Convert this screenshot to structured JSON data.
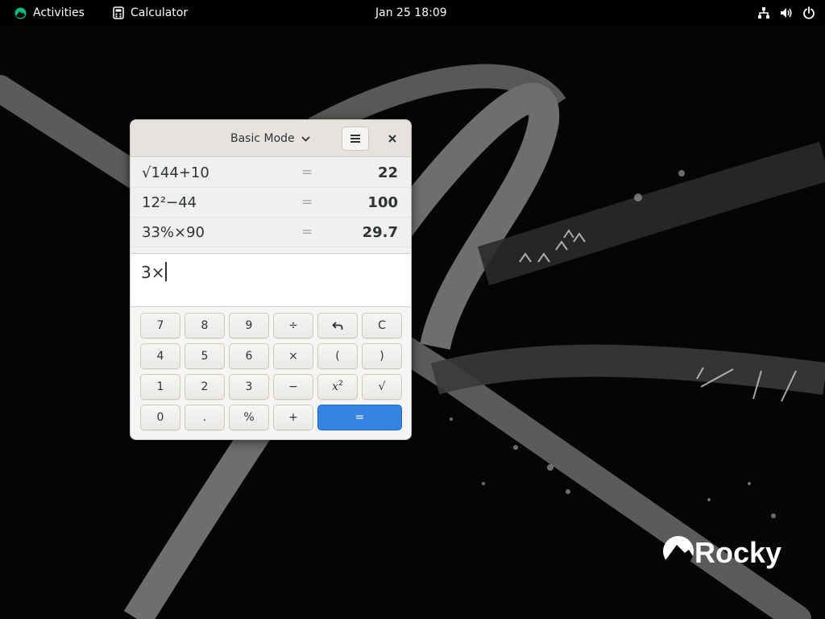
{
  "topbar": {
    "activities_label": "Activities",
    "app_name": "Calculator",
    "clock": "Jan 25  18:09"
  },
  "window": {
    "mode_label": "Basic Mode"
  },
  "history": [
    {
      "expression": "√144+10",
      "equals": "=",
      "result": "22"
    },
    {
      "expression": "12²−44",
      "equals": "=",
      "result": "100"
    },
    {
      "expression": "33%×90",
      "equals": "=",
      "result": "29.7"
    }
  ],
  "entry": {
    "value": "3×"
  },
  "keys": {
    "k7": "7",
    "k8": "8",
    "k9": "9",
    "div": "÷",
    "clear": "C",
    "k4": "4",
    "k5": "5",
    "k6": "6",
    "mul": "×",
    "lparen": "(",
    "rparen": ")",
    "k1": "1",
    "k2": "2",
    "k3": "3",
    "sub": "−",
    "sq_base": "x",
    "sq_exp": "2",
    "sqrt": "√",
    "k0": "0",
    "dot": ".",
    "pct": "%",
    "add": "+",
    "eq": "="
  },
  "icons": {
    "activities_logo": "rocky-logo-icon",
    "app_icon": "calculator-icon",
    "network": "network-icon",
    "volume": "volume-icon",
    "power": "power-icon",
    "menu": "hamburger-menu-icon",
    "close": "close-icon",
    "backspace": "undo-icon",
    "chevron": "chevron-down-icon"
  },
  "colors": {
    "accent": "#3584e4",
    "rocky_green": "#10b981"
  },
  "wallpaper": {
    "brand_text": "Rocky"
  }
}
